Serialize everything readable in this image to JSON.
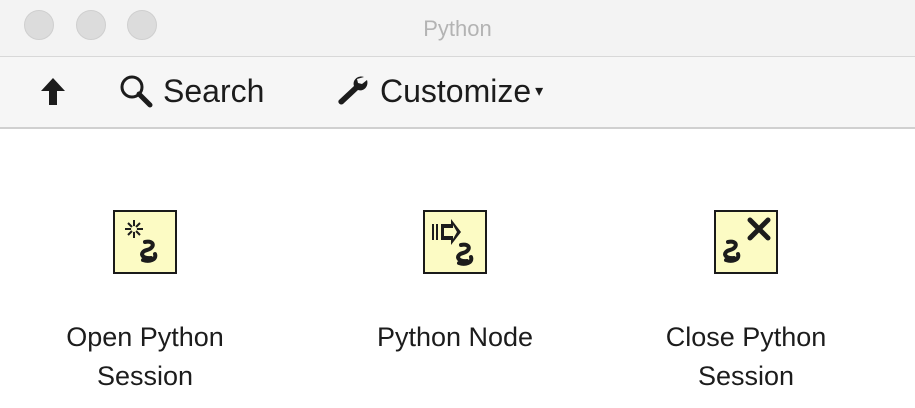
{
  "window": {
    "title": "Python"
  },
  "toolbar": {
    "up_icon": "up-arrow-icon",
    "search_label": "Search",
    "customize_label": "Customize",
    "customize_caret": "▾"
  },
  "palette": {
    "items": [
      {
        "label": "Open Python\nSession",
        "icon": "open-python-session-icon"
      },
      {
        "label": "Python Node",
        "icon": "python-node-icon"
      },
      {
        "label": "Close Python\nSession",
        "icon": "close-python-session-icon"
      }
    ]
  },
  "colors": {
    "icon_background": "#fcfbc4",
    "titlebar": "#f3f3f3",
    "title_text": "#b3b3b3"
  }
}
